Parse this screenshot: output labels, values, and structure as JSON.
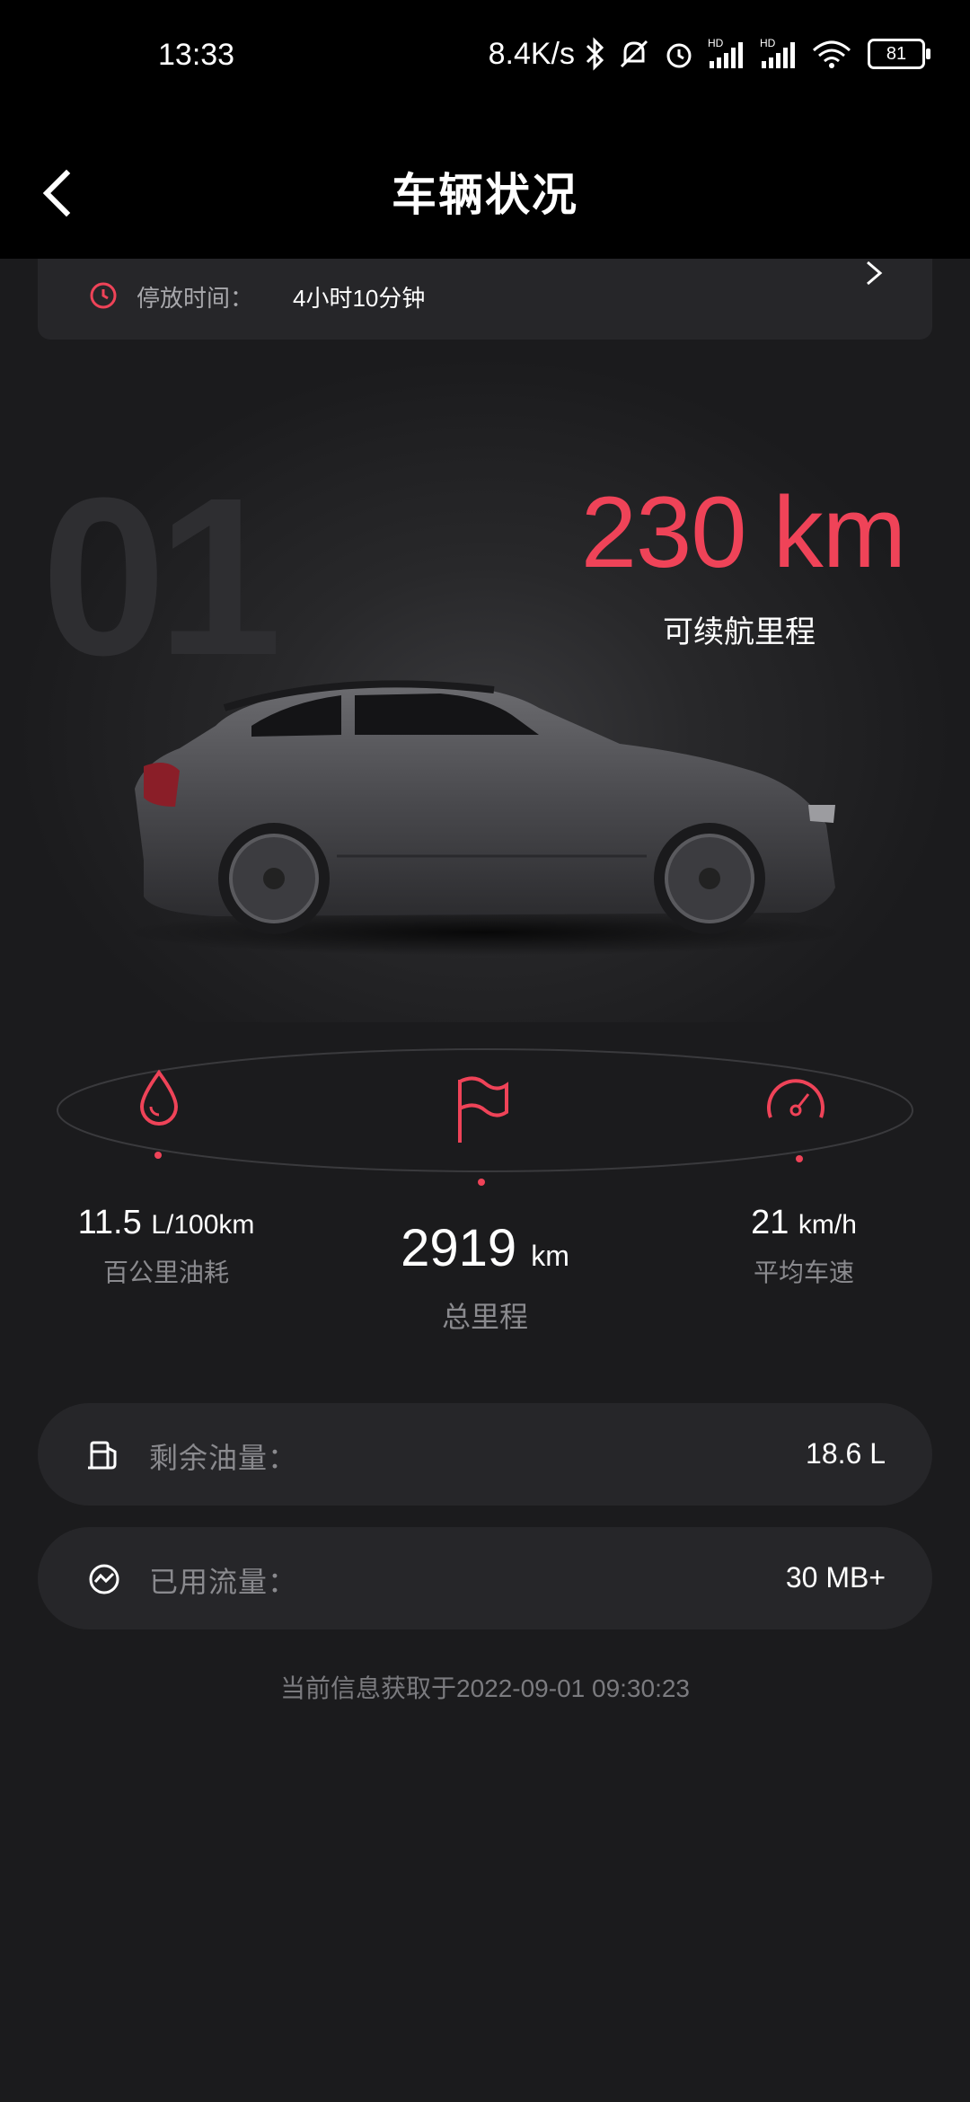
{
  "status_bar": {
    "time": "13:33",
    "net_speed": "8.4K/s",
    "battery": "81",
    "icons": [
      "bluetooth-icon",
      "mute-icon",
      "alarm-icon",
      "signal-hd-icon",
      "signal-hd-icon",
      "wifi-icon",
      "battery-icon"
    ]
  },
  "header": {
    "title": "车辆状况",
    "back_icon": "chevron-left-icon"
  },
  "parking": {
    "label": "停放时间：",
    "value": "4小时10分钟",
    "icon": "clock-icon"
  },
  "range": {
    "value": "230 km",
    "label": "可续航里程",
    "watermark": "01"
  },
  "stats": {
    "fuel_consumption": {
      "value": "11.5",
      "unit": "L/100km",
      "label": "百公里油耗",
      "icon": "drop-icon"
    },
    "total_mileage": {
      "value": "2919",
      "unit": "km",
      "label": "总里程",
      "icon": "flag-icon"
    },
    "avg_speed": {
      "value": "21",
      "unit": "km/h",
      "label": "平均车速",
      "icon": "speedometer-icon"
    }
  },
  "info": {
    "fuel_remaining": {
      "label": "剩余油量：",
      "value": "18.6 L",
      "icon": "fuel-pump-icon"
    },
    "data_used": {
      "label": "已用流量：",
      "value": "30 MB+",
      "icon": "data-usage-icon"
    }
  },
  "footer": {
    "timestamp": "当前信息获取于2022-09-01 09:30:23"
  },
  "colors": {
    "accent": "#ef4358",
    "background": "#1b1b1d",
    "card": "#262629",
    "muted": "#8a8a8e"
  }
}
